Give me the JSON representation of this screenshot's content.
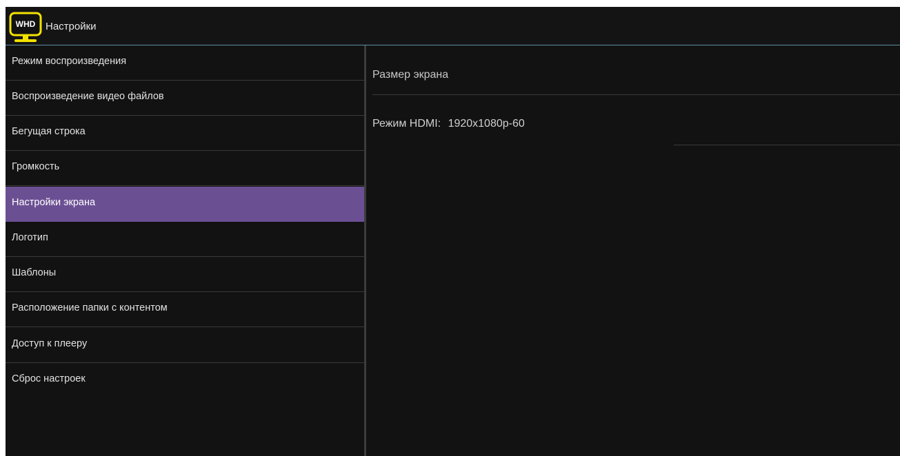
{
  "app": {
    "logo_text": "WHD",
    "title": "Настройки"
  },
  "colors": {
    "logo_yellow": "#f2e200",
    "active_item": "#6b4f93",
    "divider_accent": "#5f8fa3"
  },
  "sidebar": {
    "items": [
      {
        "label": "Режим воспроизведения"
      },
      {
        "label": "Воспроизведение видео файлов"
      },
      {
        "label": "Бегущая строка"
      },
      {
        "label": "Громкость"
      },
      {
        "label": "Настройки экрана",
        "active": true
      },
      {
        "label": "Логотип"
      },
      {
        "label": "Шаблоны"
      },
      {
        "label": "Расположение папки с контентом"
      },
      {
        "label": "Доступ к плееру"
      },
      {
        "label": "Сброс настроек"
      }
    ]
  },
  "content": {
    "heading": "Размер экрана",
    "hdmi": {
      "label": "Режим HDMI:",
      "value": "1920x1080p-60"
    }
  }
}
